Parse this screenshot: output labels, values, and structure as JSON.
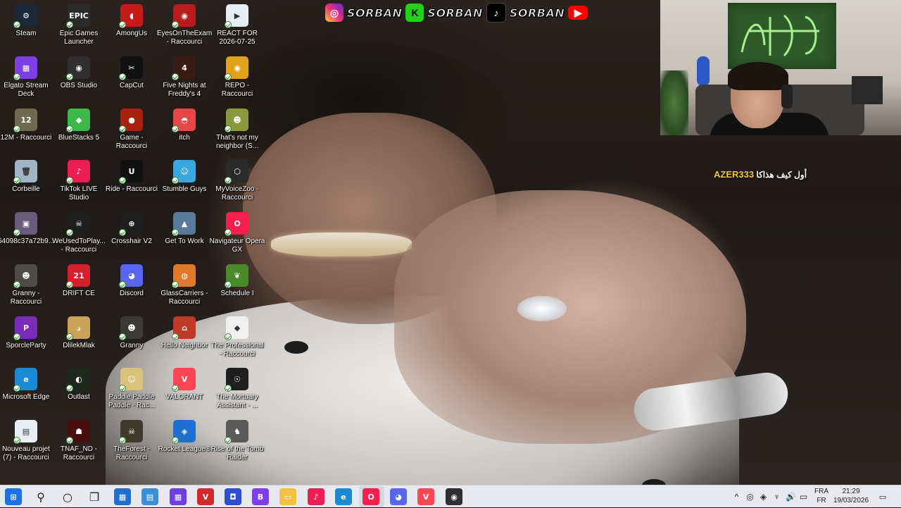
{
  "social": {
    "handles": [
      "SORBAN",
      "SORBAN",
      "SORBAN"
    ],
    "icons": [
      "instagram-icon",
      "kick-icon",
      "tiktok-icon",
      "youtube-icon"
    ]
  },
  "overlay": {
    "user": "AZER333",
    "message": "أول كيف هذاكا"
  },
  "desktop": {
    "icons": [
      {
        "label": "Steam",
        "name": "steam-icon",
        "glyph": "⚙",
        "color": "#1b2838"
      },
      {
        "label": "Elgato Stream Deck",
        "name": "elgato-stream-deck-icon",
        "glyph": "▦",
        "color": "#7b3fe4"
      },
      {
        "label": "12M - Raccourci",
        "name": "12m-icon",
        "glyph": "12",
        "color": "#6d6a4f"
      },
      {
        "label": "Corbeille",
        "name": "recycle-bin-icon",
        "glyph": "🗑",
        "color": "#9fb4c4"
      },
      {
        "label": "64098c37a72b9...",
        "name": "image-file-icon",
        "glyph": "▣",
        "color": "#6a5a7c"
      },
      {
        "label": "Granny - Raccourci",
        "name": "granny-shortcut-icon",
        "glyph": "☻",
        "color": "#4e4a44"
      },
      {
        "label": "SporcleParty",
        "name": "sporcleparty-icon",
        "glyph": "P",
        "color": "#7a2bb8"
      },
      {
        "label": "Microsoft Edge",
        "name": "microsoft-edge-icon",
        "glyph": "e",
        "color": "#1a8ad4"
      },
      {
        "label": "Nouveau projet (7) - Raccourci",
        "name": "new-project-icon",
        "glyph": "▤",
        "color": "#e8eef2"
      },
      {
        "label": "Epic Games Launcher",
        "name": "epic-games-icon",
        "glyph": "EPIC",
        "color": "#2a2a2a"
      },
      {
        "label": "OBS Studio",
        "name": "obs-studio-icon",
        "glyph": "◉",
        "color": "#302e31"
      },
      {
        "label": "BlueStacks 5",
        "name": "bluestacks-icon",
        "glyph": "◆",
        "color": "#3db84a"
      },
      {
        "label": "TikTok LIVE Studio",
        "name": "tiktok-live-icon",
        "glyph": "♪",
        "color": "#ee1d52"
      },
      {
        "label": "WeUsedToPlay... - Raccourci",
        "name": "weusedtoplay-icon",
        "glyph": "☠",
        "color": "#1e1e1e"
      },
      {
        "label": "DRIFT CE",
        "name": "drift-ce-icon",
        "glyph": "21",
        "color": "#d4202a"
      },
      {
        "label": "DlilekMlak",
        "name": "dlilekmlak-icon",
        "glyph": "د",
        "color": "#c9a45a"
      },
      {
        "label": "Outlast",
        "name": "outlast-icon",
        "glyph": "◐",
        "color": "#1f2a1f"
      },
      {
        "label": "TNAF_ND - Raccourci",
        "name": "tnaf-nd-icon",
        "glyph": "☗",
        "color": "#4a1010"
      },
      {
        "label": "AmongUs",
        "name": "among-us-icon",
        "glyph": "◖",
        "color": "#c61b1b"
      },
      {
        "label": "CapCut",
        "name": "capcut-icon",
        "glyph": "✂",
        "color": "#111111"
      },
      {
        "label": "Game - Raccourci",
        "name": "game-shortcut-icon",
        "glyph": "●",
        "color": "#a8210f"
      },
      {
        "label": "Ride - Raccourci",
        "name": "unreal-ride-icon",
        "glyph": "U",
        "color": "#111111"
      },
      {
        "label": "Crosshair V2",
        "name": "crosshair-icon",
        "glyph": "⊕",
        "color": "#1e1e1e"
      },
      {
        "label": "Discord",
        "name": "discord-icon",
        "glyph": "◕",
        "color": "#5865f2"
      },
      {
        "label": "Granny",
        "name": "granny-icon",
        "glyph": "☻",
        "color": "#3c3a36"
      },
      {
        "label": "Paddle Paddle Paddle - Rac...",
        "name": "paddle-icon",
        "glyph": "☺",
        "color": "#d9c27a"
      },
      {
        "label": "TheForest - Raccourci",
        "name": "theforest-icon",
        "glyph": "☠",
        "color": "#3d3a2c"
      },
      {
        "label": "EyesOnTheExam - Raccourci",
        "name": "eyesontheexam-icon",
        "glyph": "◉",
        "color": "#b81d1d"
      },
      {
        "label": "Five Nights at Freddy's 4",
        "name": "fnaf4-icon",
        "glyph": "4",
        "color": "#3a1c12"
      },
      {
        "label": "itch",
        "name": "itch-icon",
        "glyph": "◓",
        "color": "#e54848"
      },
      {
        "label": "Stumble Guys",
        "name": "stumble-guys-icon",
        "glyph": "☺",
        "color": "#3aa7e0"
      },
      {
        "label": "Get To Work",
        "name": "get-to-work-icon",
        "glyph": "▲",
        "color": "#5a7a9c"
      },
      {
        "label": "GlassCarriers - Raccourci",
        "name": "glasscarriers-icon",
        "glyph": "◍",
        "color": "#e07a2a"
      },
      {
        "label": "Hello Neighbor",
        "name": "hello-neighbor-icon",
        "glyph": "⌂",
        "color": "#c03a2a"
      },
      {
        "label": "VALORANT",
        "name": "valorant-icon",
        "glyph": "V",
        "color": "#ff4655"
      },
      {
        "label": "Rocket League®",
        "name": "rocket-league-icon",
        "glyph": "◈",
        "color": "#1f6fd1"
      },
      {
        "label": "REACT FOR 2026-07-25",
        "name": "react-video-icon",
        "glyph": "▶",
        "color": "#e6edf5"
      },
      {
        "label": "REPO - Raccourci",
        "name": "repo-icon",
        "glyph": "◉",
        "color": "#e0a21a"
      },
      {
        "label": "That's not my neighbor (S...",
        "name": "thats-not-my-neighbor-icon",
        "glyph": "☻",
        "color": "#8a9a3a"
      },
      {
        "label": "MyVoiceZoo - Raccourci",
        "name": "myvoicezoo-icon",
        "glyph": "⬡",
        "color": "#2a2a2a"
      },
      {
        "label": "Navigateur Opera GX",
        "name": "opera-gx-icon",
        "glyph": "O",
        "color": "#fa1e4e"
      },
      {
        "label": "Schedule I",
        "name": "schedule-i-icon",
        "glyph": "❦",
        "color": "#4a8a2a"
      },
      {
        "label": "The Professional - Raccourci",
        "name": "the-professional-icon",
        "glyph": "◆",
        "color": "#f0f0f0"
      },
      {
        "label": "The Mortuary Assistant - ...",
        "name": "mortuary-assistant-icon",
        "glyph": "☉",
        "color": "#1e1e1e"
      },
      {
        "label": "Rise of the Tomb Raider",
        "name": "tomb-raider-icon",
        "glyph": "♞",
        "color": "#5a5a5a"
      }
    ]
  },
  "taskbar": {
    "apps": [
      {
        "name": "start-icon",
        "glyph": "⊞",
        "color": "#1a73e8"
      },
      {
        "name": "search-icon",
        "glyph": "⚲",
        "color": "#222222"
      },
      {
        "name": "cortana-icon",
        "glyph": "○",
        "color": "#222222"
      },
      {
        "name": "task-view-icon",
        "glyph": "❐",
        "color": "#222222"
      },
      {
        "name": "store-icon",
        "glyph": "▦",
        "color": "#1f6fd1"
      },
      {
        "name": "control-panel-icon",
        "glyph": "▤",
        "color": "#3a8fd6"
      },
      {
        "name": "stream-deck-icon",
        "glyph": "▦",
        "color": "#6b3fe0"
      },
      {
        "name": "voicemeeter-icon",
        "glyph": "V",
        "color": "#d22a2a"
      },
      {
        "name": "snip-icon",
        "glyph": "◘",
        "color": "#2f4fd1"
      },
      {
        "name": "beacon-icon",
        "glyph": "B",
        "color": "#7b3ff0"
      },
      {
        "name": "file-explorer-icon",
        "glyph": "▭",
        "color": "#f2c043"
      },
      {
        "name": "tiktok-taskbar-icon",
        "glyph": "♪",
        "color": "#ee1d52"
      },
      {
        "name": "edge-taskbar-icon",
        "glyph": "e",
        "color": "#1a8ad4"
      },
      {
        "name": "opera-taskbar-icon",
        "glyph": "O",
        "color": "#fa1e4e"
      },
      {
        "name": "discord-taskbar-icon",
        "glyph": "◕",
        "color": "#5865f2"
      },
      {
        "name": "valorant-taskbar-icon",
        "glyph": "V",
        "color": "#ff4655"
      },
      {
        "name": "obs-taskbar-icon",
        "glyph": "◉",
        "color": "#302e31"
      }
    ],
    "tray_glyphs": [
      "^",
      "◎",
      "◈",
      "♆",
      "🔊",
      "▭"
    ],
    "lang_top": "FRA",
    "lang_bottom": "FR",
    "time": "21:29",
    "date": "19/03/2026"
  }
}
